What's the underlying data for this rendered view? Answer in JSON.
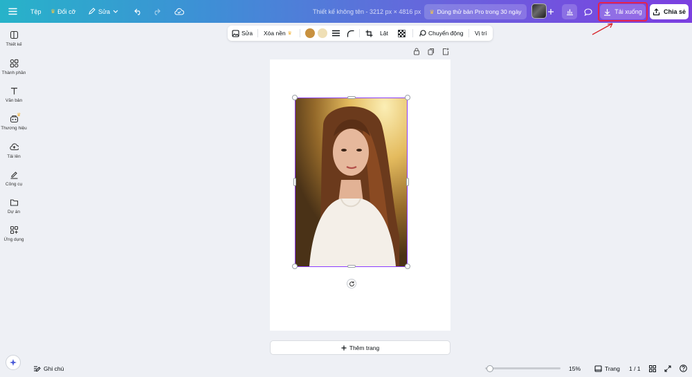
{
  "topbar": {
    "file_label": "Tệp",
    "resize_label": "Đổi cỡ",
    "edit_label": "Sửa",
    "design_title": "Thiết kế không tên - 3212 px × 4816 px",
    "pro_trial_label": "Dùng thử bản Pro trong 30 ngày",
    "download_label": "Tải xuống",
    "share_label": "Chia sẻ"
  },
  "sidebar": {
    "items": [
      {
        "label": "Thiết kế",
        "icon": "layout-icon"
      },
      {
        "label": "Thành phần",
        "icon": "shapes-icon"
      },
      {
        "label": "Văn bản",
        "icon": "text-icon"
      },
      {
        "label": "Thương hiệu",
        "icon": "brand-icon"
      },
      {
        "label": "Tải lên",
        "icon": "cloud-upload-icon"
      },
      {
        "label": "Công cụ",
        "icon": "draw-icon"
      },
      {
        "label": "Dự án",
        "icon": "folder-icon"
      },
      {
        "label": "Ứng dụng",
        "icon": "apps-icon"
      }
    ]
  },
  "context_toolbar": {
    "edit_label": "Sửa",
    "remove_bg_label": "Xóa nền",
    "flip_label": "Lật",
    "animate_label": "Chuyển động",
    "position_label": "Vị trí",
    "colors": [
      "#c8913f",
      "#efdfb5"
    ]
  },
  "canvas": {
    "add_page_label": "Thêm trang"
  },
  "bottom": {
    "notes_label": "Ghi chú",
    "zoom_value": "15%",
    "zoom_fraction": 0.06,
    "pages_label": "Trang",
    "page_count": "1 / 1"
  },
  "colors": {
    "accent": "#8b3dff",
    "highlight": "#e8234a",
    "pro_star": "#f3b43a"
  }
}
